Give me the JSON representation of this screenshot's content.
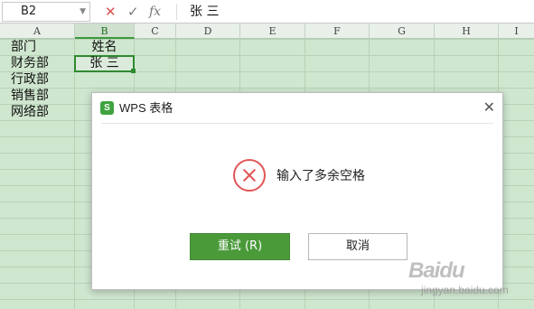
{
  "formula_bar": {
    "cell_ref": "B2",
    "cancel_icon": "x-icon",
    "confirm_icon": "check-icon",
    "function_label": "fx",
    "content": "张 三"
  },
  "columns": [
    "A",
    "B",
    "C",
    "D",
    "E",
    "F",
    "G",
    "H",
    "I"
  ],
  "active_column": "B",
  "cells": {
    "a": [
      "部门",
      "财务部",
      "行政部",
      "销售部",
      "网络部"
    ],
    "b": [
      "姓名",
      "张 三"
    ]
  },
  "dialog": {
    "logo": "S",
    "title": "WPS 表格",
    "close": "✕",
    "icon": "error-circle-icon",
    "message": "输入了多余空格",
    "retry_label": "重试 (R)",
    "cancel_label": "取消"
  },
  "watermark": {
    "brand": "Baidu",
    "sub": "jingyan.baidu.com"
  },
  "colors": {
    "accent_green": "#4a9a3a",
    "error_red": "#e05656",
    "grid_background": "#cfe6cf"
  }
}
